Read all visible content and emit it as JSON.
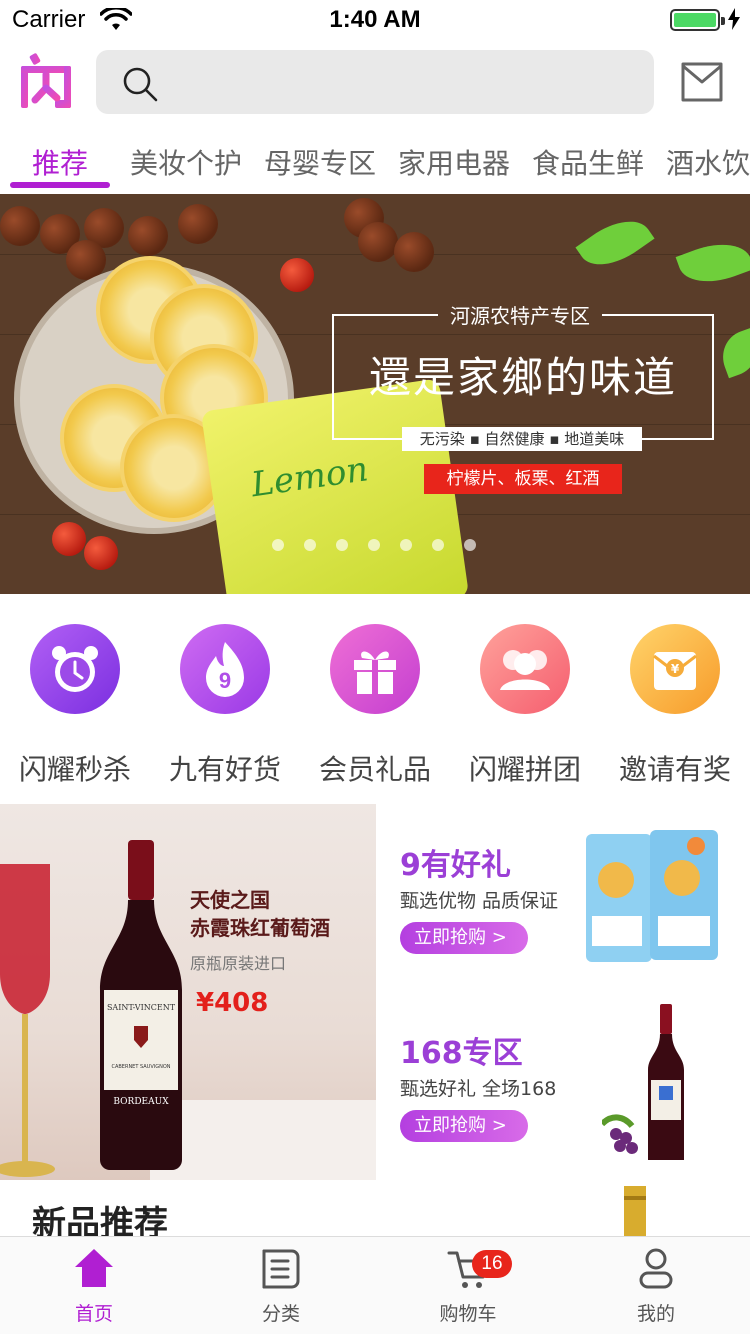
{
  "status_bar": {
    "carrier": "Carrier",
    "time": "1:40 AM",
    "battery_percent": 100
  },
  "header": {
    "logo_text": "闪",
    "search": {
      "value": "",
      "placeholder": ""
    },
    "icons": {
      "search": "search-icon",
      "mail": "mail-icon"
    }
  },
  "tabs": [
    {
      "label": "推荐",
      "active": true
    },
    {
      "label": "美妆个护",
      "active": false
    },
    {
      "label": "母婴专区",
      "active": false
    },
    {
      "label": "家用电器",
      "active": false
    },
    {
      "label": "食品生鲜",
      "active": false
    },
    {
      "label": "酒水饮",
      "active": false
    }
  ],
  "banner": {
    "subtitle": "河源农特产专区",
    "headline": "還是家鄉的味道",
    "features": "无污染 ▪ 自然健康 ▪ 地道美味",
    "products": "柠檬片、板栗、红酒",
    "package_text": "Lemon",
    "slide_count": 7,
    "active_slide": 0
  },
  "quick_entries": [
    {
      "label": "闪耀秒杀",
      "icon": "alarm-clock-icon",
      "color_from": "#b260f5",
      "color_to": "#7b2fe0"
    },
    {
      "label": "九有好货",
      "icon": "flame-nine-icon",
      "color_from": "#cf6cf2",
      "color_to": "#9a39e6"
    },
    {
      "label": "会员礼品",
      "icon": "gift-icon",
      "color_from": "#ef6fd5",
      "color_to": "#c43fd0"
    },
    {
      "label": "闪耀拼团",
      "icon": "group-icon",
      "color_from": "#ffa29b",
      "color_to": "#f55e6f"
    },
    {
      "label": "邀请有奖",
      "icon": "red-envelope-icon",
      "color_from": "#ffd46b",
      "color_to": "#f79b2a"
    }
  ],
  "promo_main": {
    "title_line1": "天使之国",
    "title_line2": "赤霞珠红葡萄酒",
    "subtitle": "原瓶原装进口",
    "price": "¥408",
    "bottle_label_top": "SAINT-VINCENT",
    "bottle_label_mid": "CABERNET SAUVIGNON",
    "bottle_label_bottom": "BORDEAUX"
  },
  "promo_cards": [
    {
      "title": "9有好礼",
      "desc": "甄选优物 品质保证",
      "button": "立即抢购 >",
      "image": "snack-bags-image"
    },
    {
      "title": "168专区",
      "desc": "甄选好礼 全场168",
      "button": "立即抢购 >",
      "image": "wine-bottle-image"
    }
  ],
  "new_products": {
    "title": "新品推荐"
  },
  "tab_bar": {
    "items": [
      {
        "label": "首页",
        "icon": "home-icon",
        "active": true
      },
      {
        "label": "分类",
        "icon": "list-icon",
        "active": false
      },
      {
        "label": "购物车",
        "icon": "cart-icon",
        "active": false
      },
      {
        "label": "我的",
        "icon": "user-icon",
        "active": false
      }
    ],
    "cart_badge": "16"
  },
  "colors": {
    "accent": "#b01fd2",
    "price_red": "#e3201b",
    "badge_red": "#e8251b"
  }
}
